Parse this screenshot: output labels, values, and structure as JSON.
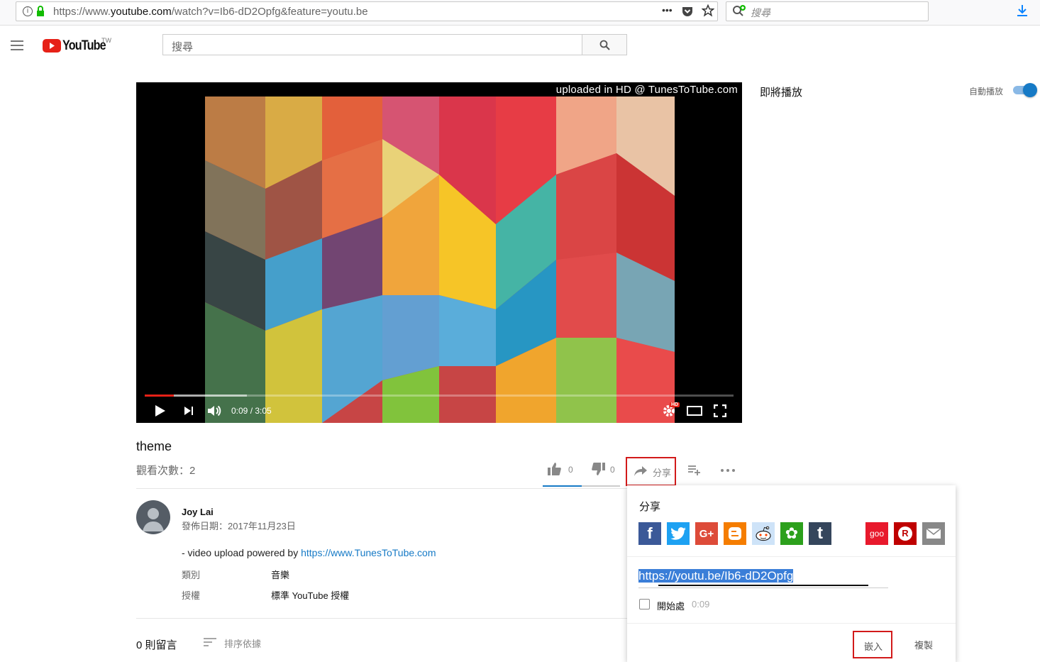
{
  "browser": {
    "url_prefix": "https://www.",
    "url_domain": "youtube.com",
    "url_path": "/watch?v=Ib6-dD2Opfg&feature=youtu.be",
    "more_label": "•••",
    "search_placeholder": "搜尋"
  },
  "youtube": {
    "logo_text": "YouTube",
    "region": "TW",
    "search_placeholder": "搜尋"
  },
  "player": {
    "watermark": "uploaded in HD @ TunesToTube.com",
    "time": "0:09 / 3:05",
    "progress_fraction": 0.049,
    "buffered_fraction": 0.174,
    "hd_badge": "HD"
  },
  "video": {
    "title": "theme",
    "views": "觀看次數：2",
    "likes": "0",
    "dislikes": "0",
    "share_label": "分享"
  },
  "channel": {
    "name": "Joy Lai",
    "published": "發佈日期：2017年11月23日",
    "description_prefix": "- video upload powered by ",
    "description_link": "https://www.TunesToTube.com",
    "meta": [
      {
        "label": "類別",
        "value": "音樂"
      },
      {
        "label": "授權",
        "value": "標準 YouTube 授權"
      }
    ]
  },
  "comments": {
    "count_label": "0 則留言",
    "sort_label": "排序依據"
  },
  "sidebar": {
    "up_next": "即將播放",
    "autoplay": "自動播放",
    "autoplay_on": true
  },
  "share_panel": {
    "title": "分享",
    "networks": [
      {
        "name": "facebook",
        "glyph": "f",
        "color": "#3b5998"
      },
      {
        "name": "twitter",
        "glyph": "🐦",
        "color": "#1da1f2"
      },
      {
        "name": "google-plus",
        "glyph": "G+",
        "color": "#dd4b39"
      },
      {
        "name": "blogger",
        "glyph": "B",
        "color": "#f57d00"
      },
      {
        "name": "reddit",
        "glyph": "👽",
        "color": "#cee3f8"
      },
      {
        "name": "vk-share",
        "glyph": "✿",
        "color": "#2ca01c"
      },
      {
        "name": "tumblr",
        "glyph": "t",
        "color": "#35465c"
      },
      {
        "name": "goo",
        "glyph": "goo",
        "color": "#e8192c"
      },
      {
        "name": "rakuten",
        "glyph": "R",
        "color": "#bf0000"
      },
      {
        "name": "email",
        "glyph": "✉",
        "color": "#888888"
      }
    ],
    "link": "https://youtu.be/Ib6-dD2Opfg",
    "start_at_label": "開始處",
    "start_at_time": "0:09",
    "embed_label": "嵌入",
    "copy_label": "複製"
  }
}
